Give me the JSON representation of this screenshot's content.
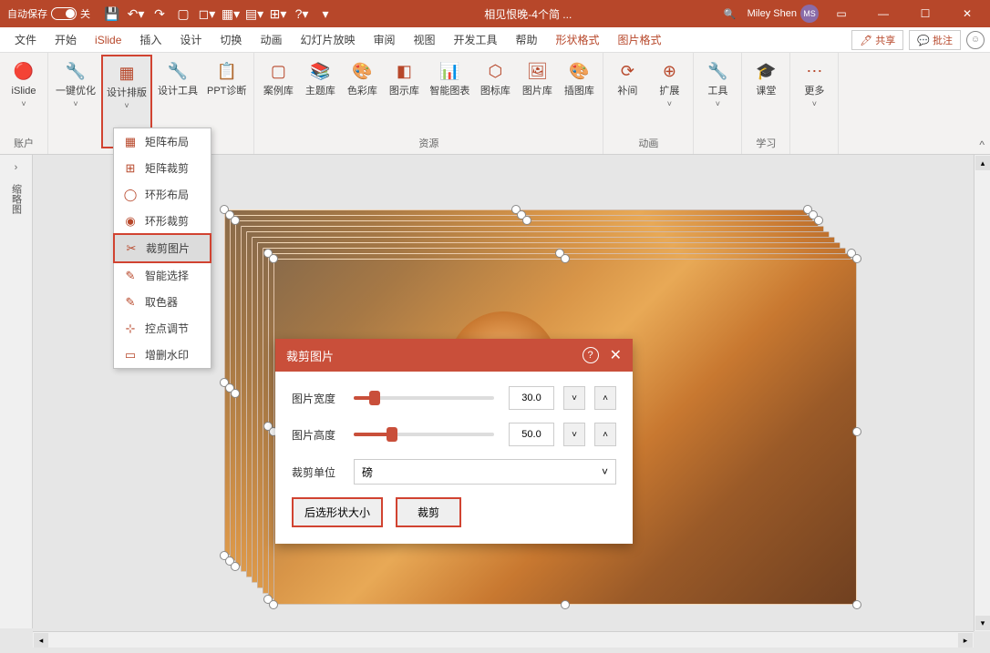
{
  "titlebar": {
    "autosave_label": "自动保存",
    "autosave_off": "关",
    "doc_title": "相见恨晚-4个简 ...",
    "user_name": "Miley Shen",
    "user_initials": "MS"
  },
  "menu": {
    "items": [
      "文件",
      "开始",
      "iSlide",
      "插入",
      "设计",
      "切换",
      "动画",
      "幻灯片放映",
      "审阅",
      "视图",
      "开发工具",
      "帮助",
      "形状格式",
      "图片格式"
    ],
    "active": 2,
    "share": "共享",
    "comment": "批注"
  },
  "ribbon": {
    "groups": [
      {
        "label": "账户",
        "btns": [
          {
            "label": "iSlide",
            "drop": true
          }
        ]
      },
      {
        "label": "",
        "btns": [
          {
            "label": "一键优化",
            "drop": true
          },
          {
            "label": "设计排版",
            "drop": true,
            "hl": true
          },
          {
            "label": "设计工具"
          },
          {
            "label": "PPT诊断"
          }
        ]
      },
      {
        "label": "资源",
        "btns": [
          {
            "label": "案例库"
          },
          {
            "label": "主题库"
          },
          {
            "label": "色彩库"
          },
          {
            "label": "图示库"
          },
          {
            "label": "智能图表"
          },
          {
            "label": "图标库"
          },
          {
            "label": "图片库"
          },
          {
            "label": "插图库"
          }
        ]
      },
      {
        "label": "动画",
        "btns": [
          {
            "label": "补间"
          },
          {
            "label": "扩展",
            "drop": true
          }
        ]
      },
      {
        "label": "",
        "btns": [
          {
            "label": "工具",
            "drop": true
          }
        ]
      },
      {
        "label": "学习",
        "btns": [
          {
            "label": "课堂"
          }
        ]
      },
      {
        "label": "",
        "btns": [
          {
            "label": "更多",
            "drop": true
          }
        ]
      }
    ]
  },
  "dropdown": {
    "items": [
      {
        "icon": "grid",
        "label": "矩阵布局"
      },
      {
        "icon": "grid-crop",
        "label": "矩阵裁剪"
      },
      {
        "icon": "ring",
        "label": "环形布局"
      },
      {
        "icon": "ring-crop",
        "label": "环形裁剪"
      },
      {
        "icon": "crop",
        "label": "裁剪图片",
        "sel": true
      },
      {
        "icon": "wand",
        "label": "智能选择"
      },
      {
        "icon": "dropper",
        "label": "取色器"
      },
      {
        "icon": "nodes",
        "label": "控点调节"
      },
      {
        "icon": "watermark",
        "label": "增删水印"
      }
    ]
  },
  "leftpane": {
    "label": "缩略图"
  },
  "dialog": {
    "title": "裁剪图片",
    "row1_label": "图片宽度",
    "row1_value": "30.0",
    "row1_pct": 15,
    "row2_label": "图片高度",
    "row2_value": "50.0",
    "row2_pct": 27,
    "row3_label": "裁剪单位",
    "unit": "磅",
    "btn1": "后选形状大小",
    "btn2": "裁剪"
  }
}
